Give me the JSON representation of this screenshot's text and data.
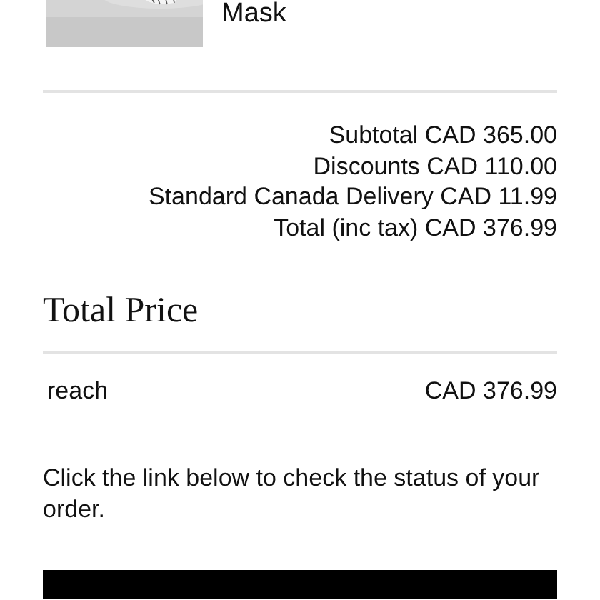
{
  "product": {
    "name": "Mask"
  },
  "summary": [
    {
      "label": "Subtotal",
      "value": "CAD 365.00"
    },
    {
      "label": "Discounts",
      "value": "CAD 110.00"
    },
    {
      "label": "Standard Canada Delivery",
      "value": "CAD 11.99"
    },
    {
      "label": "Total (inc tax)",
      "value": "CAD 376.99"
    }
  ],
  "total_price": {
    "heading": "Total Price",
    "rows": [
      {
        "label": "reach",
        "value": "CAD 376.99"
      }
    ]
  },
  "note": "Click the link below to check the status of your order."
}
